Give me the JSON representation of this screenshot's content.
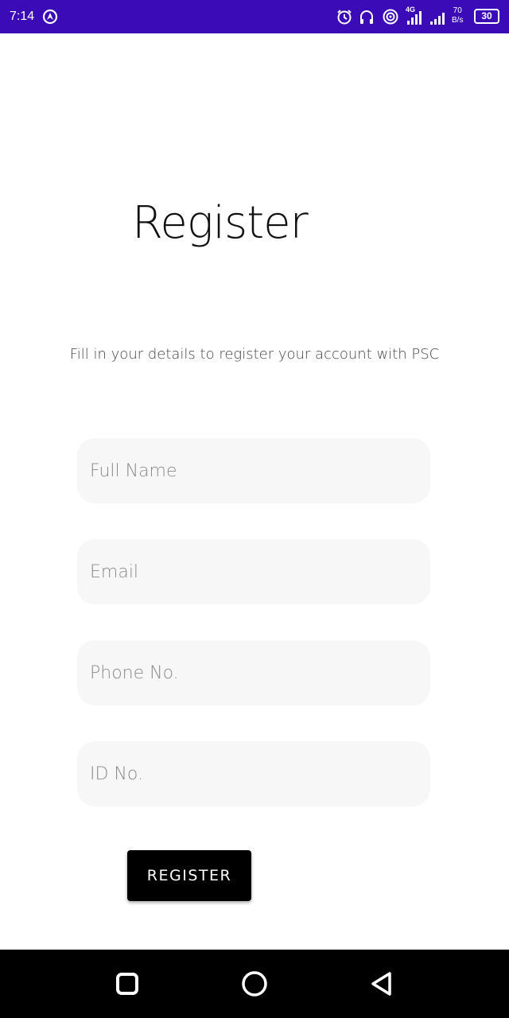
{
  "status_bar": {
    "time": "7:14",
    "network_type": "4G",
    "speed_value": "70",
    "speed_unit": "B/s",
    "battery": "30",
    "icons": [
      "location-icon",
      "alarm-icon",
      "headset-icon",
      "hotspot-icon",
      "signal-icon",
      "signal-icon-2"
    ],
    "background_color": "#3b0bb8"
  },
  "title": "Register",
  "subtitle": "Fill in your details to register your account with PSC",
  "form": {
    "full_name_placeholder": "Full Name",
    "email_placeholder": "Email",
    "phone_placeholder": "Phone No.",
    "id_placeholder": "ID No."
  },
  "register_button": "REGISTER",
  "nav_bar": {
    "icons": [
      "recents-icon",
      "home-icon",
      "back-icon"
    ]
  }
}
